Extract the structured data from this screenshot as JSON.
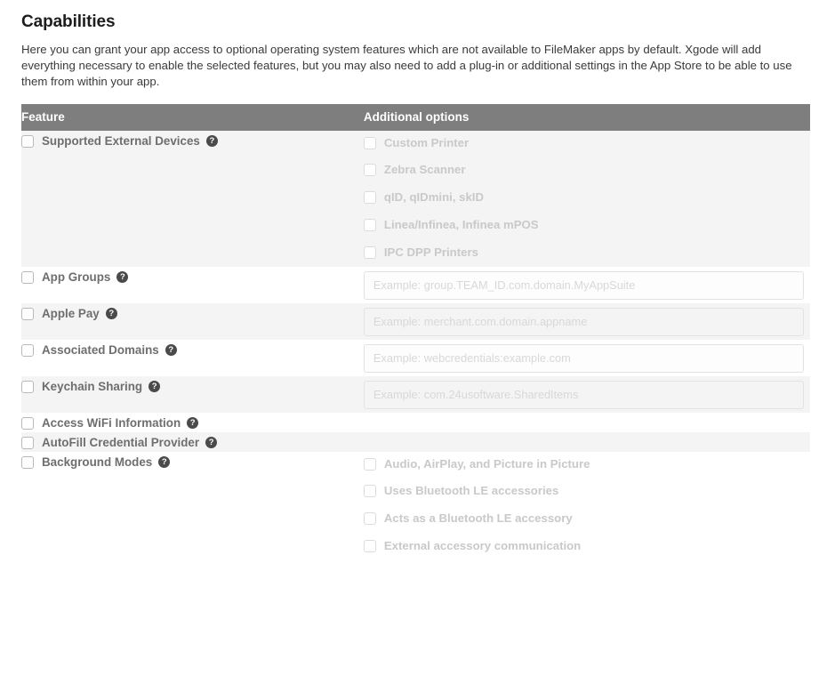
{
  "page": {
    "title": "Capabilities",
    "description": "Here you can grant your app access to optional operating system features which are not available to FileMaker apps by default. Xgode will add everything necessary to enable the selected features, but you may also need to add a plug-in or additional settings in the App Store to be able to use them from within your app."
  },
  "table": {
    "headers": {
      "feature": "Feature",
      "options": "Additional options"
    },
    "help_glyph": "?",
    "rows": [
      {
        "feature": "Supported External Devices",
        "help": "?",
        "checked": false,
        "type": "suboptions",
        "options": [
          "Custom Printer",
          "Zebra Scanner",
          "qID, qIDmini, skID",
          "Linea/Infinea, Infinea mPOS",
          "IPC DPP Printers"
        ]
      },
      {
        "feature": "App Groups",
        "help": "?",
        "checked": false,
        "type": "input",
        "placeholder": "Example: group.TEAM_ID.com.domain.MyAppSuite",
        "value": ""
      },
      {
        "feature": "Apple Pay",
        "help": "?",
        "checked": false,
        "type": "input",
        "placeholder": "Example: merchant.com.domain.appname",
        "value": ""
      },
      {
        "feature": "Associated Domains",
        "help": "?",
        "checked": false,
        "type": "input",
        "placeholder": "Example: webcredentials:example.com",
        "value": ""
      },
      {
        "feature": "Keychain Sharing",
        "help": "?",
        "checked": false,
        "type": "input",
        "placeholder": "Example: com.24usoftware.SharedItems",
        "value": ""
      },
      {
        "feature": "Access WiFi Information",
        "help": "?",
        "checked": false,
        "type": "none"
      },
      {
        "feature": "AutoFill Credential Provider",
        "help": "?",
        "checked": false,
        "type": "none"
      },
      {
        "feature": "Background Modes",
        "help": "?",
        "checked": false,
        "type": "suboptions",
        "options": [
          "Audio, AirPlay, and Picture in Picture",
          "Uses Bluetooth LE accessories",
          "Acts as a Bluetooth LE accessory",
          "External accessory communication"
        ]
      }
    ]
  },
  "colors": {
    "header_bg": "#7e7e7e",
    "row_shaded": "#f4f4f4",
    "row_plain": "#ffffff",
    "feature_text": "#6e6e6e",
    "option_text": "#c9c9c9",
    "help_icon_bg": "#4a4a4a"
  }
}
